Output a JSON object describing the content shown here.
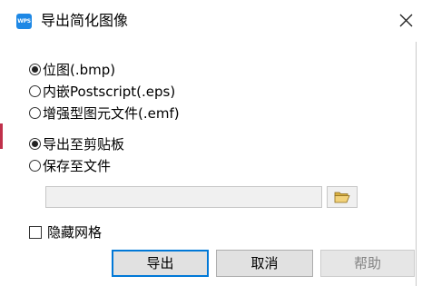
{
  "window": {
    "icon_text": "WPS",
    "title": "导出简化图像",
    "close_glyph": "✕"
  },
  "format_options": [
    {
      "label": "位图(.bmp)",
      "checked": true
    },
    {
      "label": "内嵌Postscript(.eps)",
      "checked": false
    },
    {
      "label": "增强型图元文件(.emf)",
      "checked": false
    }
  ],
  "destination_options": [
    {
      "label": "导出至剪贴板",
      "checked": true
    },
    {
      "label": "保存至文件",
      "checked": false
    }
  ],
  "file_path": {
    "value": ""
  },
  "browse": {
    "icon": "folder-open-icon"
  },
  "hide_grid": {
    "label": "隐藏网格",
    "checked": false
  },
  "buttons": {
    "export": "导出",
    "cancel": "取消",
    "help": "帮助"
  },
  "colors": {
    "accent": "#0078d7",
    "folder": "#e8c35a"
  }
}
